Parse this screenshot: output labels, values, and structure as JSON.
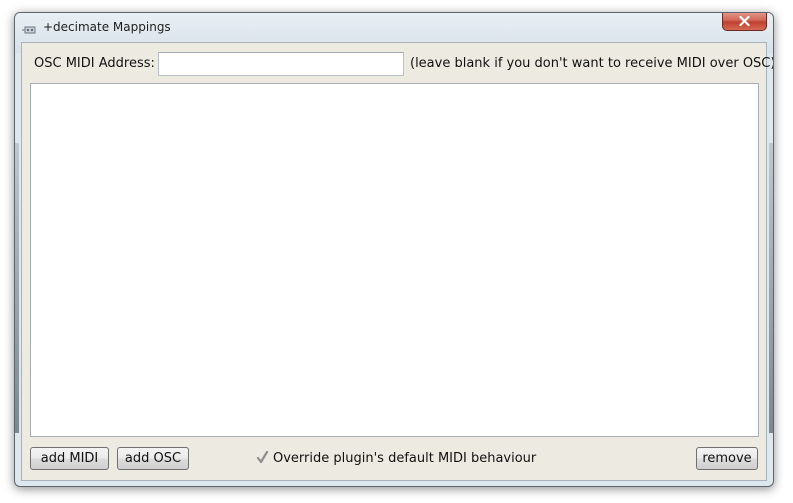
{
  "window": {
    "title": "+decimate Mappings"
  },
  "osc": {
    "label": "OSC MIDI Address:",
    "value": "",
    "placeholder": "",
    "hint": "(leave blank if you don't want to receive MIDI over OSC)"
  },
  "mappings": {
    "items": []
  },
  "buttons": {
    "add_midi": "add MIDI",
    "add_osc": "add OSC",
    "remove": "remove"
  },
  "override": {
    "label": "Override plugin's default MIDI behaviour",
    "checked": true
  },
  "icons": {
    "app": "app-icon",
    "close": "close-icon",
    "check": "checkmark-icon"
  },
  "colors": {
    "close_button": "#c9503f",
    "client_background": "#edebe1",
    "list_background": "#ffffff"
  }
}
